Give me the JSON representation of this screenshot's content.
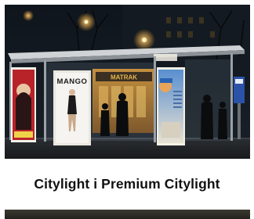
{
  "caption": "Citylight i Premium Citylight",
  "photo": {
    "alt": "Bus shelter with backlit advertising panels at night",
    "ad_brand": "MANGO",
    "shop_sign": "MATRAK"
  },
  "colors": {
    "caption_text": "#111111",
    "background": "#ffffff",
    "shelter_light": "#f3f1e6"
  }
}
